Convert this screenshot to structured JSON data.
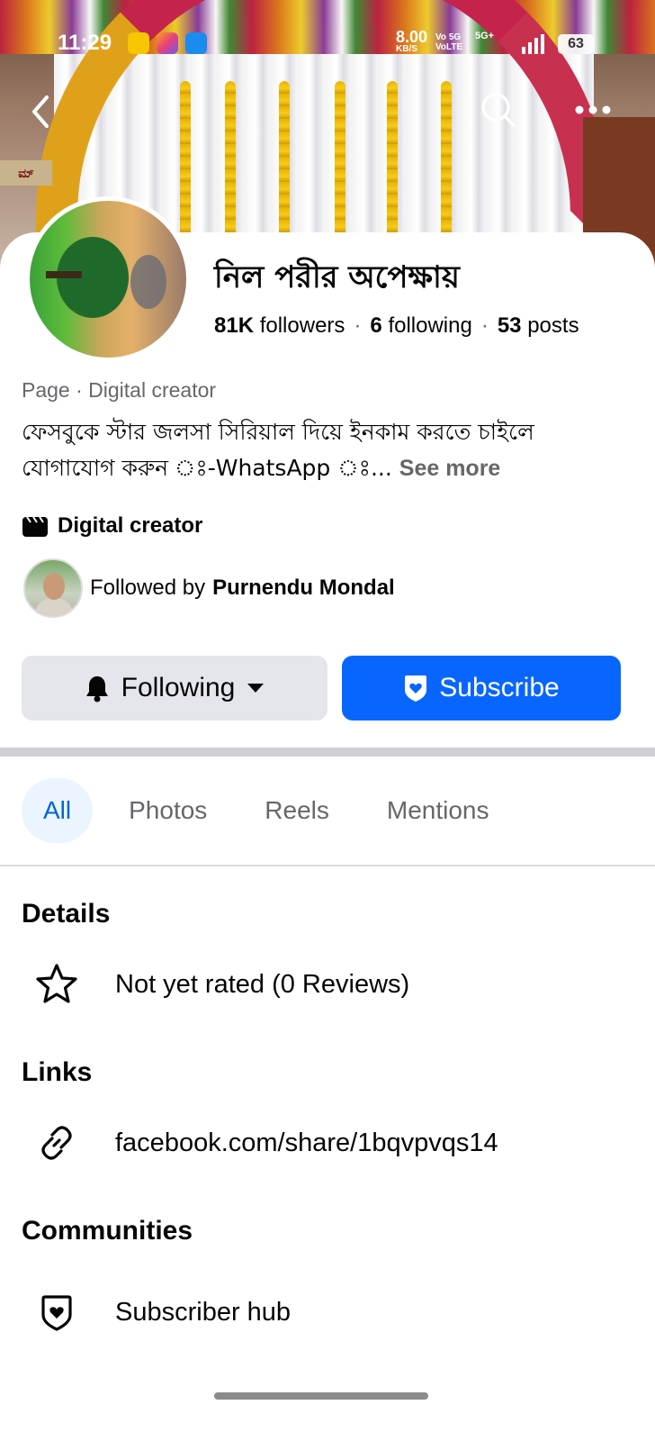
{
  "status_bar": {
    "time": "11:29",
    "net_speed": "8.00",
    "net_unit": "KB/S",
    "volte": "Vo 5G\nVoLTE",
    "fiveg": "5G+",
    "battery": "63"
  },
  "cover": {
    "sign_text": "ಮ್"
  },
  "profile": {
    "name": "নিল পরীর অপেক্ষায়",
    "followers_count": "81K",
    "followers_label": "followers",
    "following_count": "6",
    "following_label": "following",
    "posts_count": "53",
    "posts_label": "posts",
    "separator": "·",
    "category": "Page · Digital creator",
    "bio": "ফেসবুকে স্টার জলসা সিরিয়াল দিয়ে ইনকাম করতে চাইলে যোগাযোগ করুন ঃ-WhatsApp ঃ...",
    "see_more": "See more",
    "creator_label": "Digital creator",
    "followed_by_prefix": "Followed by",
    "followed_by_name": "Purnendu Mondal"
  },
  "actions": {
    "following_label": "Following",
    "subscribe_label": "Subscribe"
  },
  "tabs": [
    {
      "label": "All",
      "active": true
    },
    {
      "label": "Photos",
      "active": false
    },
    {
      "label": "Reels",
      "active": false
    },
    {
      "label": "Mentions",
      "active": false
    }
  ],
  "details": {
    "title": "Details",
    "rating": "Not yet rated (0 Reviews)"
  },
  "links": {
    "title": "Links",
    "url": "facebook.com/share/1bqvpvqs14"
  },
  "communities": {
    "title": "Communities",
    "item": "Subscriber hub"
  },
  "colors": {
    "primary": "#0866ff",
    "tab_active_bg": "#ebf5ff",
    "tab_active_text": "#0064d1",
    "secondary_text": "#65676b"
  }
}
